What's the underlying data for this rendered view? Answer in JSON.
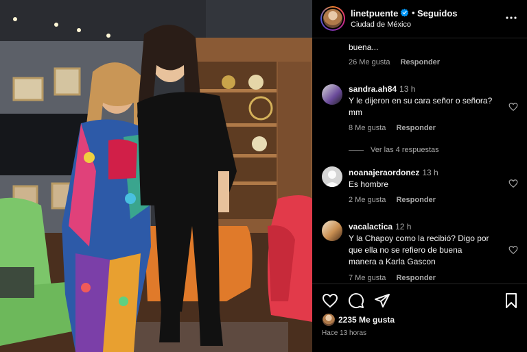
{
  "post": {
    "username": "linetpuente",
    "follow_status": "Seguidos",
    "location": "Ciudad de México",
    "likes": "2235 Me gusta",
    "time_ago": "Hace 13 horas"
  },
  "comments": [
    {
      "lines": [
        "buena..."
      ],
      "likes": "26 Me gusta",
      "reply": "Responder"
    },
    {
      "user": "sandra.ah84",
      "time": "13 h",
      "lines": [
        "Y le dijeron en su cara señor o señora?",
        "mm"
      ],
      "likes": "8 Me gusta",
      "reply": "Responder",
      "view_replies": "Ver las 4 respuestas"
    },
    {
      "user": "noanajeraordonez",
      "time": "13 h",
      "lines": [
        "Es hombre"
      ],
      "likes": "2 Me gusta",
      "reply": "Responder"
    },
    {
      "user": "vacalactica",
      "time": "12 h",
      "lines": [
        "Y la Chapoy como la recibió? Digo por",
        "que ella no se refiero de buena",
        "manera a Karla Gascon"
      ],
      "likes": "7 Me gusta",
      "reply": "Responder"
    }
  ],
  "icons": {
    "verified": "verified-badge-icon",
    "more": "more-options-icon",
    "like": "heart-icon",
    "comment": "comment-bubble-icon",
    "share": "paper-plane-icon",
    "save": "bookmark-icon"
  },
  "colors": {
    "background": "#000000",
    "text": "#f5f5f5",
    "secondary_text": "#a8a8a8",
    "verified_blue": "#0095f6"
  }
}
